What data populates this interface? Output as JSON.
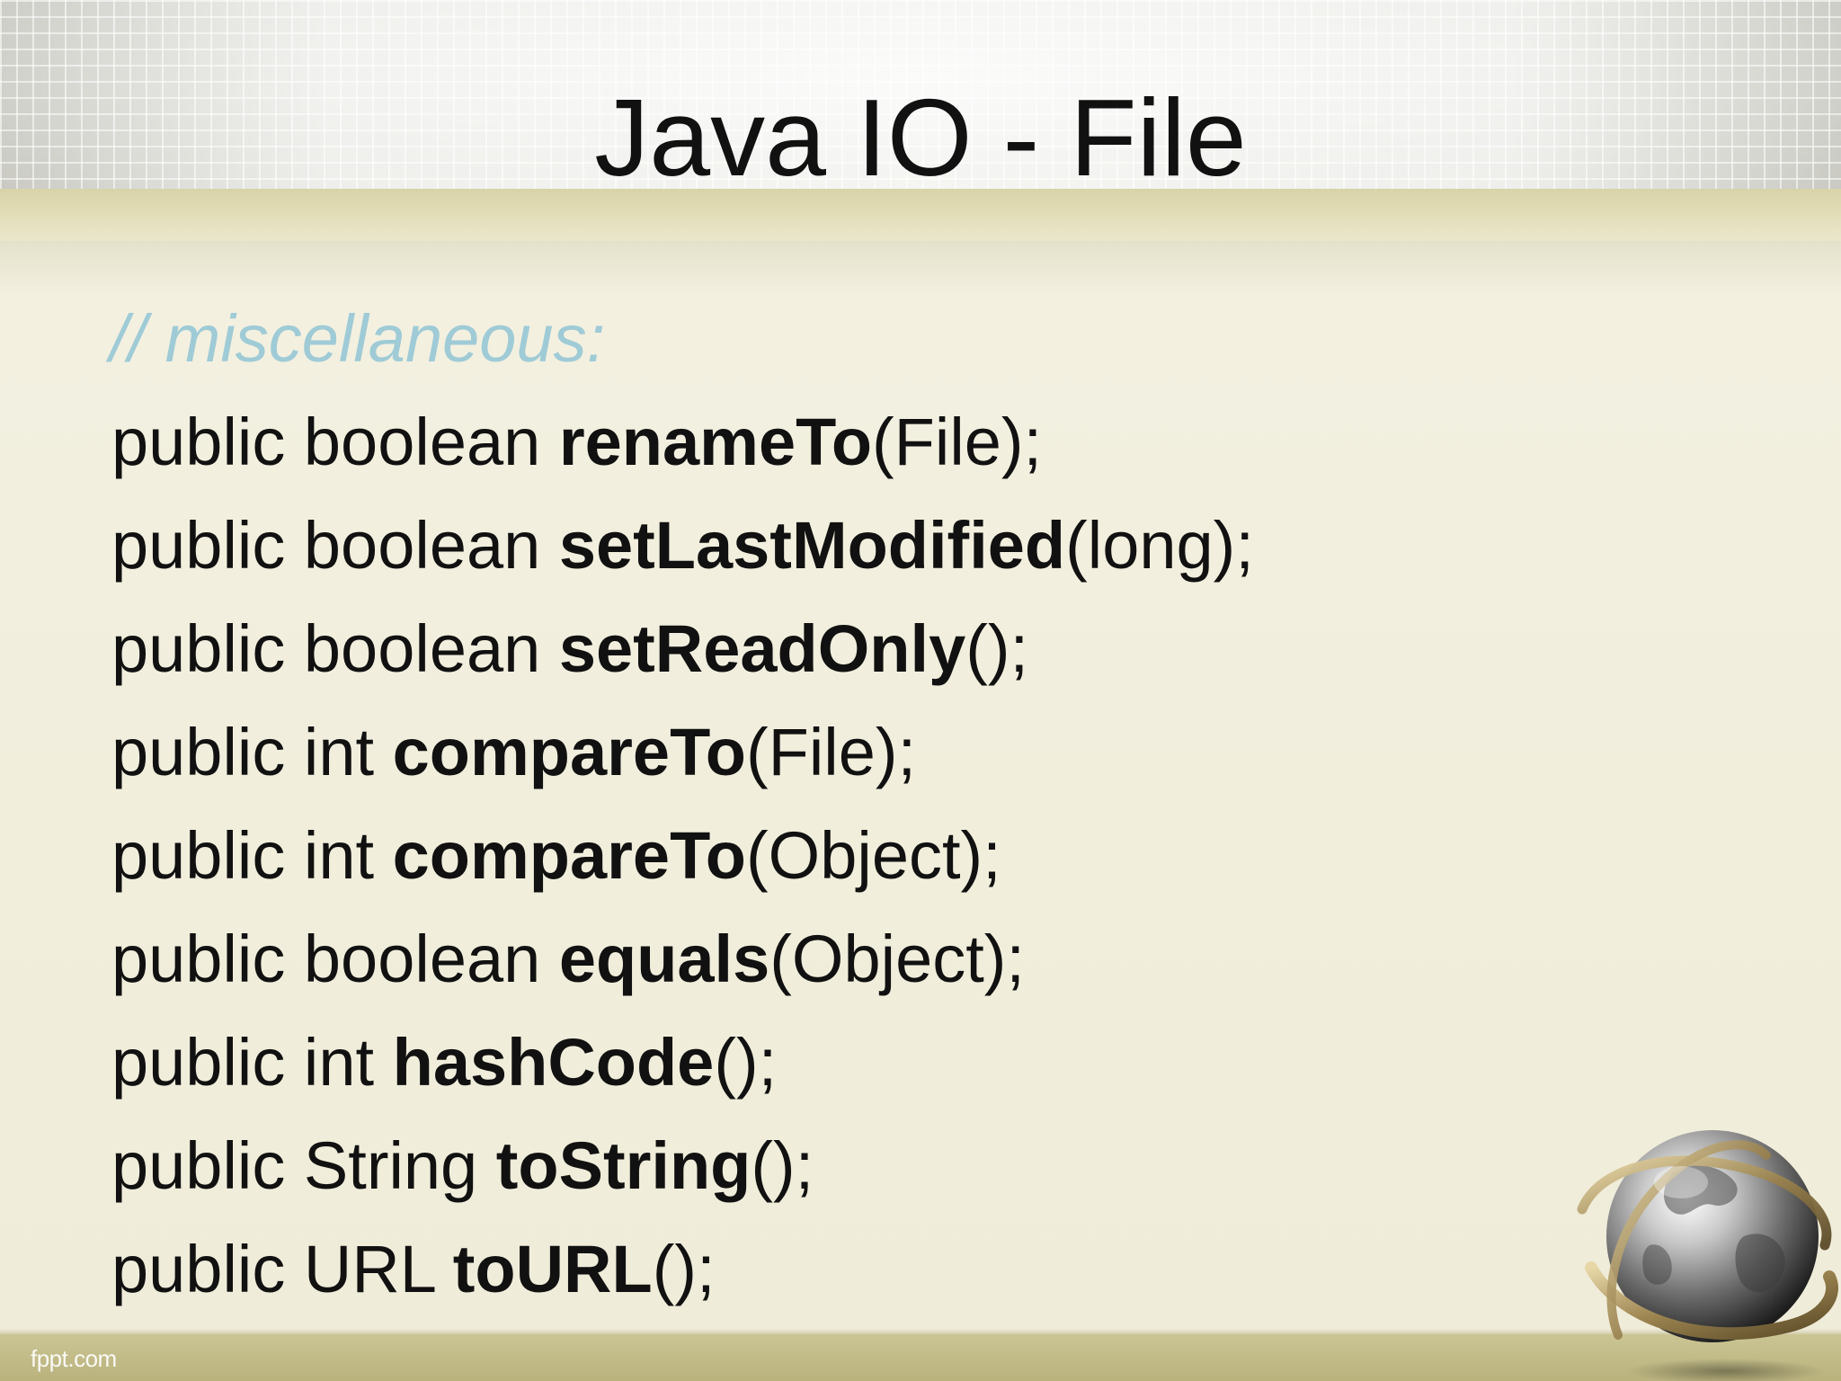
{
  "slide": {
    "title": "Java IO - File",
    "comment": "// miscellaneous:",
    "lines": [
      {
        "prefix": "public boolean ",
        "method": "renameTo",
        "suffix": "(File);"
      },
      {
        "prefix": "public boolean ",
        "method": "setLastModified",
        "suffix": "(long);"
      },
      {
        "prefix": "public boolean ",
        "method": "setReadOnly",
        "suffix": "();"
      },
      {
        "prefix": "public int ",
        "method": "compareTo",
        "suffix": "(File);"
      },
      {
        "prefix": "public int ",
        "method": "compareTo",
        "suffix": "(Object);"
      },
      {
        "prefix": "public boolean ",
        "method": "equals",
        "suffix": "(Object);"
      },
      {
        "prefix": "public int ",
        "method": "hashCode",
        "suffix": "();"
      },
      {
        "prefix": "public String ",
        "method": "toString",
        "suffix": "();"
      },
      {
        "prefix": "public URL ",
        "method": "toURL",
        "suffix": "();"
      }
    ]
  },
  "footer": {
    "brand": "fppt.com"
  },
  "decor": {
    "globe_icon": "globe-with-rings-icon"
  },
  "colors": {
    "comment": "#9fcbd6",
    "text": "#111111",
    "footer_band": "#c4bd88"
  }
}
